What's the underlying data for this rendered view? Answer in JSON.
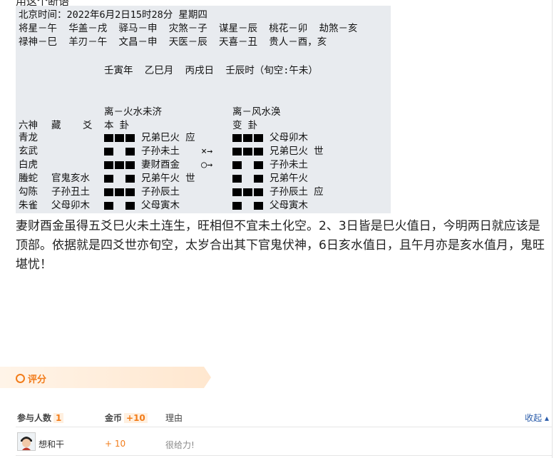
{
  "top_partial_text": "用这个断语",
  "divination": {
    "header_lines": [
      "北京时间：2022年6月2日15时28分 星期四",
      "将星－午  华盖－戌  驿马－申  灾煞－子  谋星－辰  桃花－卯  劫煞－亥",
      "禄神－巳  羊刃－午  文昌－申  天医－辰  天喜－丑  贵人－酉，亥"
    ],
    "ganzhi": "壬寅年  乙巳月  丙戌日  壬辰时（旬空:午未）",
    "ben_gua_title": "离－火水未济",
    "bian_gua_title": "离－风水涣",
    "col_headers": {
      "liushen": "六神",
      "cang": "藏",
      "yao": "爻",
      "ben": "本  卦",
      "bian": "变  卦"
    },
    "rows": [
      {
        "liushen": "青龙",
        "fushen": "",
        "ben_yang": true,
        "ben_label": "兄弟巳火 应",
        "move": "",
        "bian_yang": true,
        "bian_label": "父母卯木"
      },
      {
        "liushen": "玄武",
        "fushen": "",
        "ben_yang": false,
        "ben_label": "子孙未土",
        "move": "×→",
        "bian_yang": true,
        "bian_label": "兄弟巳火 世"
      },
      {
        "liushen": "白虎",
        "fushen": "",
        "ben_yang": true,
        "ben_label": "妻财酉金",
        "move": "○→",
        "bian_yang": false,
        "bian_label": "子孙未土"
      },
      {
        "liushen": "螣蛇",
        "fushen": "官鬼亥水",
        "ben_yang": false,
        "ben_label": "兄弟午火 世",
        "move": "",
        "bian_yang": false,
        "bian_label": "兄弟午火"
      },
      {
        "liushen": "勾陈",
        "fushen": "子孙丑土",
        "ben_yang": true,
        "ben_label": "子孙辰土",
        "move": "",
        "bian_yang": true,
        "bian_label": "子孙辰土 应"
      },
      {
        "liushen": "朱雀",
        "fushen": "父母卯木",
        "ben_yang": false,
        "ben_label": "父母寅木",
        "move": "",
        "bian_yang": false,
        "bian_label": "父母寅木"
      }
    ]
  },
  "post_text": "妻财酉金虽得五爻巳火未土连生，旺相但不宜未土化空。2、3日皆是巳火值日，今明两日就应该是顶部。依据就是四爻世亦旬空，太岁合出其下官鬼伏神，6日亥水值日，且午月亦是亥水值月，鬼旺堪忧！",
  "rating": {
    "title": "评分",
    "participants_label": "参与人数",
    "participants_count": "1",
    "coins_label": "金币",
    "coins_total": "+10",
    "reason_label": "理由",
    "collapse_label": "收起",
    "entries": [
      {
        "user": "想和干",
        "coins": "+ 10",
        "reason": "很给力!"
      }
    ]
  },
  "colors": {
    "accent": "#f27c1a",
    "link": "#2a5caa",
    "panel": "#e8ebef"
  }
}
